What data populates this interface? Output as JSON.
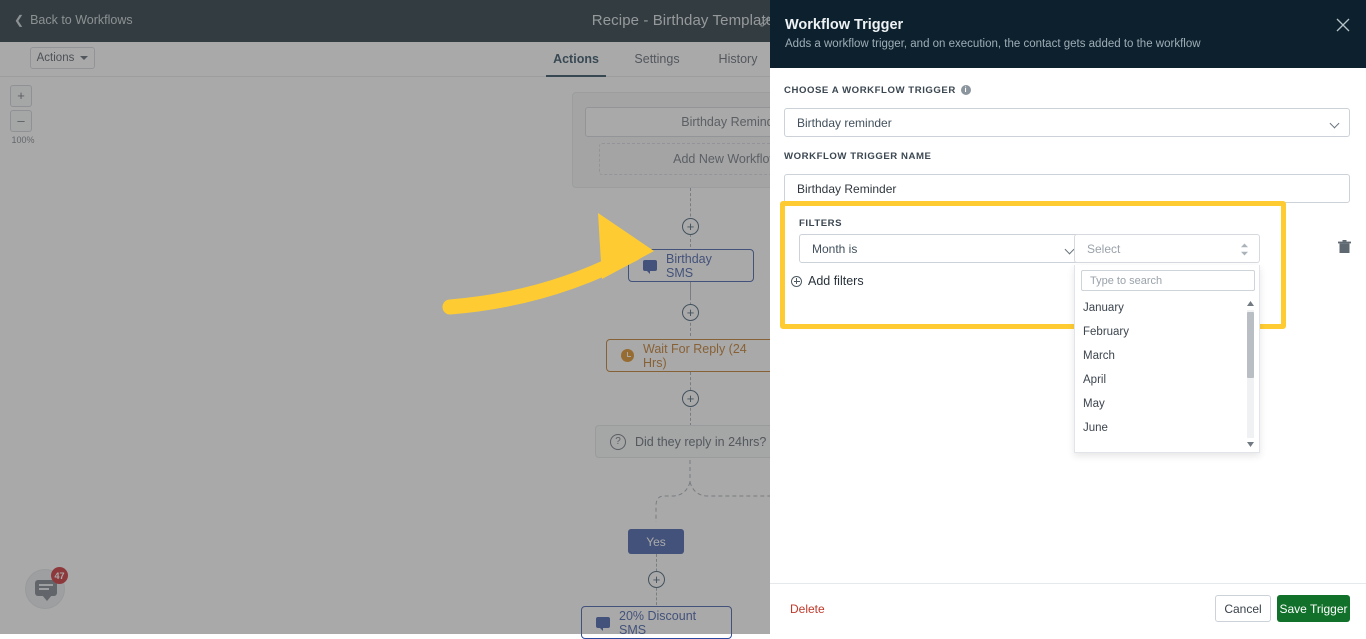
{
  "topbar": {
    "back_label": "Back to Workflows",
    "recipe_title": "Recipe - Birthday Template"
  },
  "tabs": [
    {
      "label": "Actions",
      "active": true
    },
    {
      "label": "Settings",
      "active": false
    },
    {
      "label": "History",
      "active": false
    }
  ],
  "toolbar": {
    "actions_label": "Actions"
  },
  "canvas": {
    "zoom_in": "+",
    "zoom_out": "–",
    "zoom_level": "100%",
    "trigger_box": {
      "trigger_name": "Birthday Reminder",
      "add_trigger_label": "Add New Workflow Trigger"
    },
    "nodes": [
      {
        "label": "Birthday SMS",
        "icon": "sms-icon",
        "type": "sms"
      },
      {
        "label": "Wait For Reply (24 Hrs)",
        "icon": "clock-icon",
        "type": "wait"
      },
      {
        "label": "Did they reply in 24hrs?",
        "icon": "question-icon",
        "type": "condition"
      },
      {
        "label": "20% Discount SMS",
        "icon": "sms-icon",
        "type": "sms"
      }
    ],
    "branch_label_yes": "Yes",
    "plus_label": "+"
  },
  "chat_widget": {
    "badge_count": "47"
  },
  "panel": {
    "title": "Workflow Trigger",
    "subtitle": "Adds a workflow trigger, and on execution, the contact gets added to the workflow",
    "close_label": "✕",
    "choose_trigger_label": "CHOOSE A WORKFLOW TRIGGER",
    "choose_trigger_value": "Birthday reminder",
    "trigger_name_label": "WORKFLOW TRIGGER NAME",
    "trigger_name_value": "Birthday Reminder",
    "filters_label": "FILTERS",
    "filter_condition_value": "Month is",
    "filter_value_placeholder": "Select",
    "add_filters_label": "Add filters",
    "dropdown": {
      "search_placeholder": "Type to search",
      "options": [
        "January",
        "February",
        "March",
        "April",
        "May",
        "June"
      ]
    },
    "footer": {
      "delete_label": "Delete",
      "cancel_label": "Cancel",
      "save_label": "Save Trigger"
    }
  },
  "colors": {
    "header_dark": "#0a1c26",
    "panel_header_dark": "#0c212d",
    "highlight_yellow": "#fecc32",
    "save_green": "#11702a",
    "delete_red": "#c0392b",
    "node_blue": "#2b4a9e",
    "node_orange": "#b96a10",
    "badge_red": "#c4151c"
  }
}
